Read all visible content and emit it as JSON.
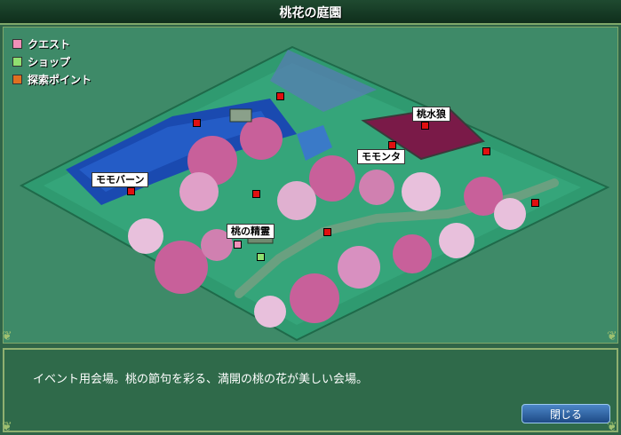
{
  "window": {
    "title": "桃花の庭園"
  },
  "legend": [
    {
      "label": "クエスト",
      "color": "#f090b8"
    },
    {
      "label": "ショップ",
      "color": "#90e070"
    },
    {
      "label": "探索ポイント",
      "color": "#e07020"
    }
  ],
  "map_labels": {
    "momo_bern": "モモバーン",
    "peach_water_wolf": "桃水狼",
    "momonta": "モモンタ",
    "peach_spirit": "桃の精霊"
  },
  "description": "イベント用会場。桃の節句を彩る、満開の桃の花が美しい会場。",
  "buttons": {
    "close": "閉じる"
  },
  "colors": {
    "frame": "#2f6448",
    "ground": "#2f9a70",
    "river": "#1a4ab0",
    "blossom": "#c8609a",
    "accent": "#7fa86a"
  }
}
